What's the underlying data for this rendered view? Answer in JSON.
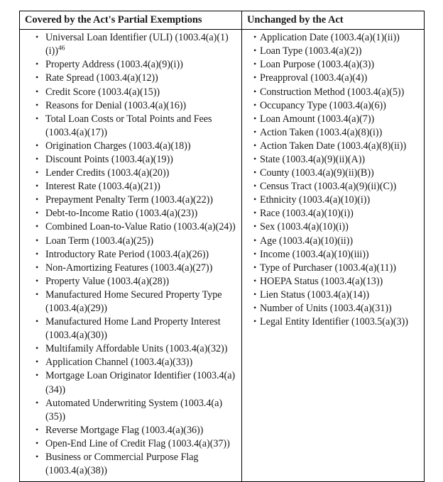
{
  "table": {
    "columns": [
      {
        "header": "Covered by the Act's Partial Exemptions",
        "items": [
          {
            "text": "Universal Loan Identifier (ULI) (1003.4(a)(1)(i))",
            "footnote": "46"
          },
          {
            "text": "Property Address (1003.4(a)(9)(i))"
          },
          {
            "text": "Rate Spread (1003.4(a)(12))"
          },
          {
            "text": "Credit Score (1003.4(a)(15))"
          },
          {
            "text": "Reasons for Denial (1003.4(a)(16))"
          },
          {
            "text": "Total Loan Costs or Total Points and Fees (1003.4(a)(17))"
          },
          {
            "text": "Origination Charges (1003.4(a)(18))"
          },
          {
            "text": "Discount Points (1003.4(a)(19))"
          },
          {
            "text": "Lender Credits (1003.4(a)(20))"
          },
          {
            "text": "Interest Rate (1003.4(a)(21))"
          },
          {
            "text": "Prepayment Penalty Term (1003.4(a)(22))"
          },
          {
            "text": "Debt-to-Income Ratio (1003.4(a)(23))"
          },
          {
            "text": "Combined Loan-to-Value Ratio (1003.4(a)(24))"
          },
          {
            "text": "Loan Term (1003.4(a)(25))"
          },
          {
            "text": "Introductory Rate Period (1003.4(a)(26))"
          },
          {
            "text": "Non-Amortizing Features (1003.4(a)(27))"
          },
          {
            "text": "Property Value (1003.4(a)(28))"
          },
          {
            "text": "Manufactured Home Secured Property Type (1003.4(a)(29))"
          },
          {
            "text": "Manufactured Home Land Property Interest (1003.4(a)(30))"
          },
          {
            "text": "Multifamily Affordable Units (1003.4(a)(32))"
          },
          {
            "text": "Application Channel (1003.4(a)(33))"
          },
          {
            "text": "Mortgage Loan Originator Identifier (1003.4(a)(34))"
          },
          {
            "text": "Automated Underwriting System (1003.4(a)(35))"
          },
          {
            "text": "Reverse Mortgage Flag (1003.4(a)(36))"
          },
          {
            "text": "Open-End Line of Credit Flag (1003.4(a)(37))"
          },
          {
            "text": "Business or Commercial Purpose Flag (1003.4(a)(38))"
          }
        ]
      },
      {
        "header": "Unchanged by the Act",
        "items": [
          {
            "text": "Application Date (1003.4(a)(1)(ii))"
          },
          {
            "text": "Loan Type (1003.4(a)(2))"
          },
          {
            "text": "Loan Purpose (1003.4(a)(3))"
          },
          {
            "text": "Preapproval (1003.4(a)(4))"
          },
          {
            "text": "Construction Method (1003.4(a)(5))"
          },
          {
            "text": "Occupancy Type (1003.4(a)(6))"
          },
          {
            "text": "Loan Amount (1003.4(a)(7))"
          },
          {
            "text": "Action Taken (1003.4(a)(8)(i))"
          },
          {
            "text": "Action Taken Date (1003.4(a)(8)(ii))"
          },
          {
            "text": "State (1003.4(a)(9)(ii)(A))"
          },
          {
            "text": "County (1003.4(a)(9)(ii)(B))"
          },
          {
            "text": "Census Tract (1003.4(a)(9)(ii)(C))"
          },
          {
            "text": "Ethnicity (1003.4(a)(10)(i))"
          },
          {
            "text": "Race (1003.4(a)(10)(i))"
          },
          {
            "text": "Sex (1003.4(a)(10)(i))"
          },
          {
            "text": "Age (1003.4(a)(10)(ii))"
          },
          {
            "text": "Income (1003.4(a)(10)(iii))"
          },
          {
            "text": "Type of Purchaser (1003.4(a)(11))"
          },
          {
            "text": "HOEPA Status (1003.4(a)(13))"
          },
          {
            "text": "Lien Status (1003.4(a)(14))"
          },
          {
            "text": "Number of Units (1003.4(a)(31))"
          },
          {
            "text": "Legal Entity Identifier (1003.5(a)(3))"
          }
        ]
      }
    ],
    "bullet_glyph": "•"
  }
}
